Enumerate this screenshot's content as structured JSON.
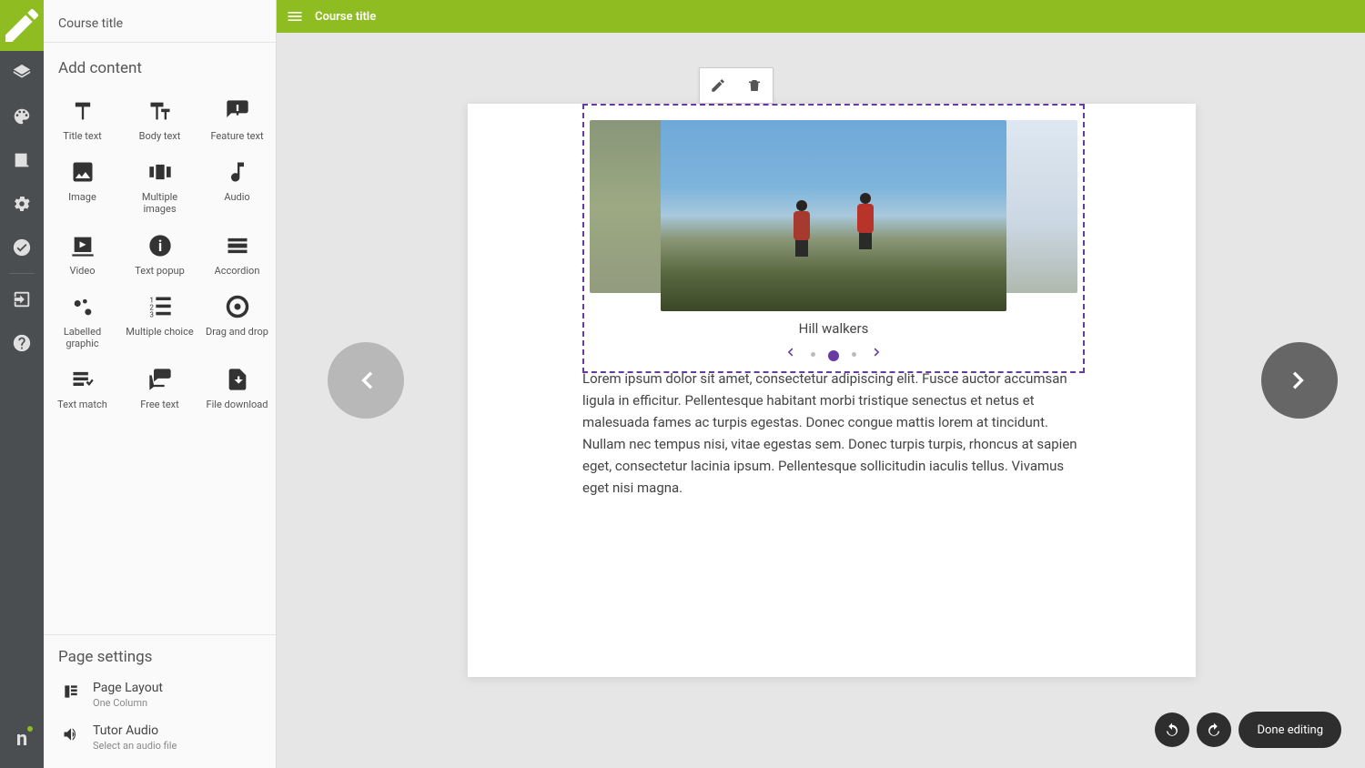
{
  "course": {
    "title": "Course title"
  },
  "header": {
    "title": "Course title"
  },
  "panel": {
    "add_content_heading": "Add content",
    "items": [
      {
        "label": "Title text"
      },
      {
        "label": "Body text"
      },
      {
        "label": "Feature text"
      },
      {
        "label": "Image"
      },
      {
        "label": "Multiple images"
      },
      {
        "label": "Audio"
      },
      {
        "label": "Video"
      },
      {
        "label": "Text popup"
      },
      {
        "label": "Accordion"
      },
      {
        "label": "Labelled graphic"
      },
      {
        "label": "Multiple choice"
      },
      {
        "label": "Drag and drop"
      },
      {
        "label": "Text match"
      },
      {
        "label": "Free text"
      },
      {
        "label": "File download"
      }
    ],
    "page_settings_heading": "Page settings",
    "settings": [
      {
        "title": "Page Layout",
        "sub": "One Column"
      },
      {
        "title": "Tutor Audio",
        "sub": "Select an audio file"
      }
    ]
  },
  "canvas": {
    "carousel": {
      "caption": "Hill walkers",
      "active_index": 1,
      "total": 3
    },
    "body_text": "Lorem ipsum dolor sit amet, consectetur adipiscing elit. Fusce auctor accumsan ligula in efficitur. Pellentesque habitant morbi tristique senectus et netus et malesuada fames ac turpis egestas. Donec congue mattis lorem at tincidunt. Nullam nec tempus nisi, vitae egestas sem. Donec turpis turpis, rhoncus at sapien eget, consectetur lacinia ipsum. Pellentesque sollicitudin iaculis tellus. Vivamus eget nisi magna."
  },
  "actions": {
    "done": "Done editing"
  }
}
